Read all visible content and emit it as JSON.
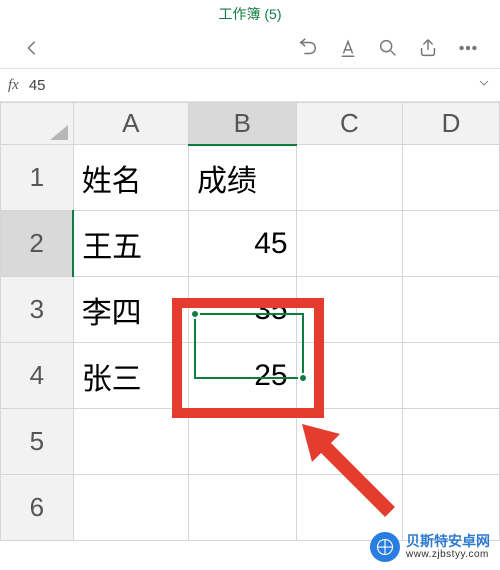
{
  "title": "工作簿 (5)",
  "formula": {
    "fx": "fx",
    "value": "45"
  },
  "columns": [
    "A",
    "B",
    "C",
    "D"
  ],
  "rows": [
    "1",
    "2",
    "3",
    "4",
    "5",
    "6"
  ],
  "selected": {
    "col": "B",
    "row": "2"
  },
  "cells": {
    "A1": "姓名",
    "B1": "成绩",
    "A2": "王五",
    "B2": "45",
    "A3": "李四",
    "B3": "35",
    "A4": "张三",
    "B4": "25"
  },
  "chart_data": {
    "type": "table",
    "headers": [
      "姓名",
      "成绩"
    ],
    "rows": [
      [
        "王五",
        45
      ],
      [
        "李四",
        35
      ],
      [
        "张三",
        25
      ]
    ]
  },
  "watermark": {
    "main": "贝斯特安卓网",
    "sub": "www.zjbstyy.com"
  }
}
